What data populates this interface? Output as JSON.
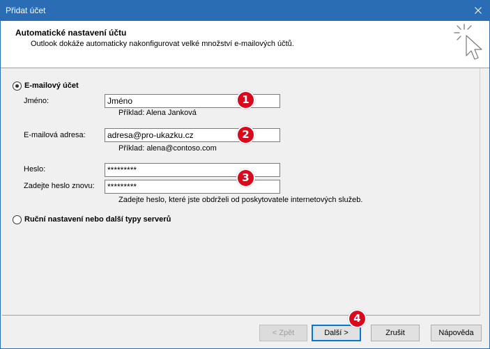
{
  "window": {
    "title": "Přidat účet"
  },
  "icons": {
    "close": "close-icon",
    "header": "cursor-sparkle-icon",
    "radio_selected": "radio-selected-icon",
    "radio_unselected": "radio-unselected-icon"
  },
  "header": {
    "title": "Automatické nastavení účtu",
    "subtitle": "Outlook dokáže automaticky nakonfigurovat velké množství e-mailových účtů."
  },
  "email_account": {
    "option_label": "E-mailový účet",
    "selected": true,
    "name": {
      "label": "Jméno:",
      "value": "Jméno",
      "hint": "Příklad: Alena Janková"
    },
    "email": {
      "label": "E-mailová adresa:",
      "value": "adresa@pro-ukazku.cz",
      "hint": "Příklad: alena@contoso.com"
    },
    "password": {
      "label": "Heslo:",
      "value": "*********"
    },
    "password_confirm": {
      "label": "Zadejte heslo znovu:",
      "value": "*********"
    },
    "password_hint": "Zadejte heslo, které jste obdrželi od poskytovatele internetových služeb."
  },
  "manual_setup": {
    "option_label": "Ruční nastavení nebo další typy serverů",
    "selected": false
  },
  "buttons": {
    "back": {
      "label": "< Zpět",
      "enabled": false
    },
    "next": {
      "label": "Další >",
      "enabled": true,
      "default": true
    },
    "cancel": {
      "label": "Zrušit"
    },
    "help": {
      "label": "Nápověda"
    }
  },
  "annotations": [
    "1",
    "2",
    "3",
    "4"
  ],
  "colors": {
    "title_bar": "#2B6DB5",
    "badge": "#D80A1E",
    "focus_border": "#0078D7"
  }
}
